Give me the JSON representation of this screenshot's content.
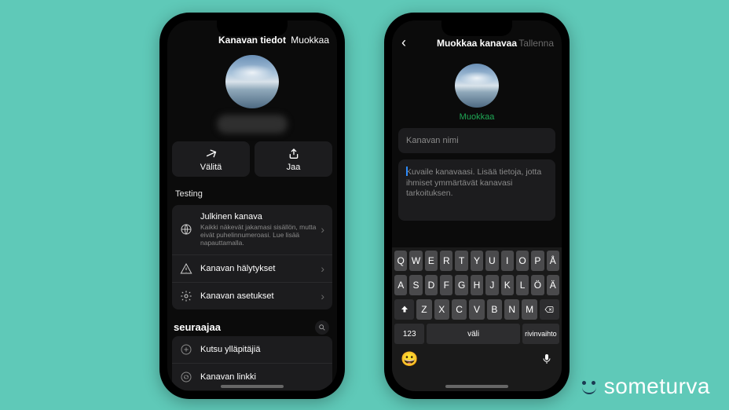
{
  "brand": "someturva",
  "phone1": {
    "header_title": "Kanavan tiedot",
    "header_action": "Muokkaa",
    "actions": {
      "forward": "Välitä",
      "share": "Jaa"
    },
    "testing_label": "Testing",
    "public_channel": {
      "title": "Julkinen kanava",
      "sub": "Kaikki näkevät jakamasi sisällön, mutta eivät puhelinnumeroasi. Lue lisää napauttamalla."
    },
    "alerts": "Kanavan hälytykset",
    "settings": "Kanavan asetukset",
    "followers_label": "seuraajaa",
    "invite": "Kutsu ylläpitäjiä",
    "link": "Kanavan linkki"
  },
  "phone2": {
    "header_title": "Muokkaa kanavaa",
    "header_save": "Tallenna",
    "edit_link": "Muokkaa",
    "name_placeholder": "Kanavan nimi",
    "desc_placeholder": "Kuvaile kanavaasi. Lisää tietoja, jotta ihmiset ymmärtävät kanavasi tarkoituksen.",
    "keyboard": {
      "row1": [
        "Q",
        "W",
        "E",
        "R",
        "T",
        "Y",
        "U",
        "I",
        "O",
        "P",
        "Å"
      ],
      "row2": [
        "A",
        "S",
        "D",
        "F",
        "G",
        "H",
        "J",
        "K",
        "L",
        "Ö",
        "Ä"
      ],
      "row3": [
        "Z",
        "X",
        "C",
        "V",
        "B",
        "N",
        "M"
      ],
      "num": "123",
      "space": "väli",
      "return": "rivinvaihto"
    }
  }
}
